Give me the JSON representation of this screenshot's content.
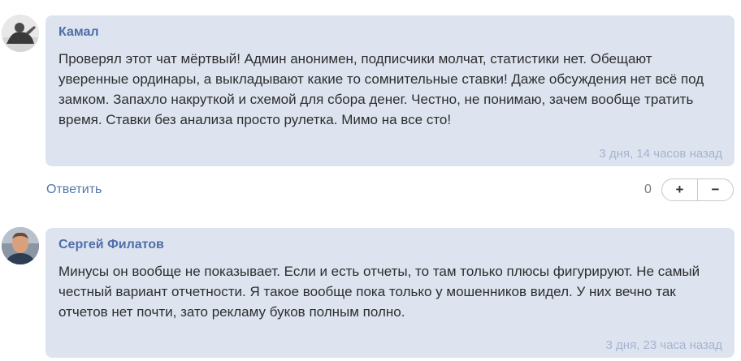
{
  "comments": [
    {
      "author": "Камал",
      "text": "Проверял этот чат мёртвый! Админ анонимен, подписчики молчат, статистики нет. Обещают уверенные ординары, а выкладывают какие то сомнительные ставки! Даже обсуждения нет всё под замком. Запахло накруткой и схемой для сбора денег. Честно, не понимаю, зачем вообще тратить время. Ставки без анализа просто рулетка. Мимо на все сто!",
      "time": "3 дня, 14 часов назад",
      "reply_label": "Ответить",
      "score": "0",
      "plus_label": "+",
      "minus_label": "−"
    },
    {
      "author": "Сергей Филатов",
      "text": "Минусы он вообще не показывает. Если и есть отчеты, то там только плюсы фигурируют. Не самый честный вариант отчетности. Я такое вообще пока только у мошенников видел. У них вечно так отчетов нет почти, зато рекламу буков полным полно.",
      "time": "3 дня, 23 часа назад"
    }
  ]
}
